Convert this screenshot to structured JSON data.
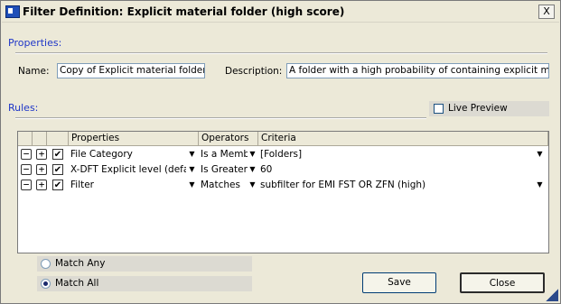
{
  "window": {
    "title": "Filter Definition: Explicit material folder (high score)",
    "close_label": "X"
  },
  "properties": {
    "section_label": "Properties:",
    "name_label": "Name:",
    "name_value": "Copy of Explicit material folder (high",
    "description_label": "Description:",
    "description_value": "A folder with a high probability of containing explicit material (DF"
  },
  "rules": {
    "section_label": "Rules:",
    "live_preview_label": "Live Preview",
    "columns": [
      "Properties",
      "Operators",
      "Criteria"
    ],
    "rows": [
      {
        "property": "File Category",
        "operator": "Is a Memb",
        "criteria": "[Folders]",
        "criteria_dropdown": true
      },
      {
        "property": "X-DFT Explicit level (default",
        "operator": "Is Greater",
        "criteria": "60",
        "criteria_dropdown": false
      },
      {
        "property": "Filter",
        "operator": "Matches",
        "criteria": "subfilter for EMI FST OR ZFN (high)",
        "criteria_dropdown": true
      }
    ]
  },
  "match": {
    "any_label": "Match Any",
    "all_label": "Match All",
    "selected": "all"
  },
  "buttons": {
    "save": "Save",
    "close": "Close"
  },
  "icons": {
    "minus": "−",
    "plus": "+",
    "check": "✔",
    "dropdown": "▼"
  }
}
